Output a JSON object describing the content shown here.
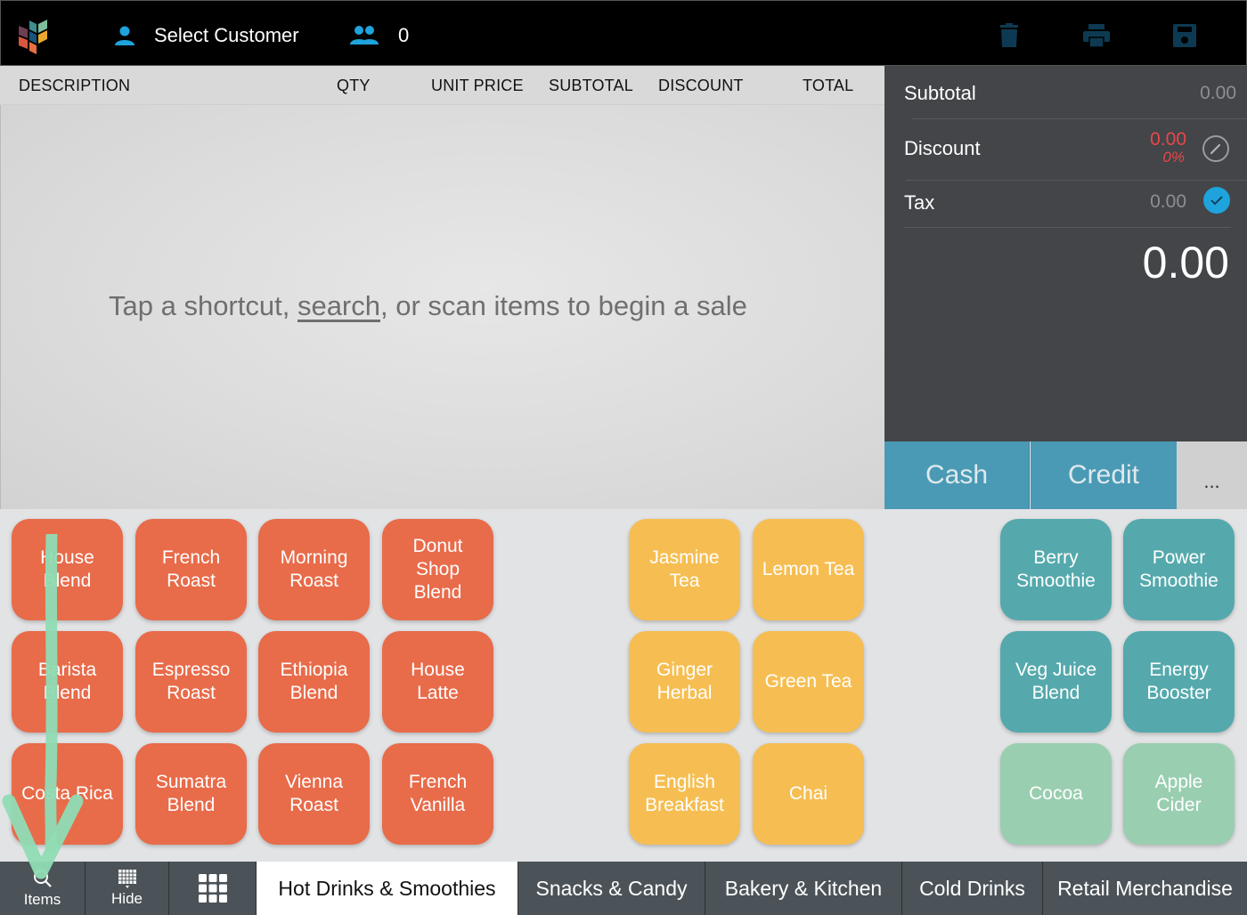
{
  "header": {
    "customer_label": "Select Customer",
    "people_count": "0",
    "icons": [
      "trash-icon",
      "printer-icon",
      "save-icon"
    ],
    "accent_color": "#1ea3dc",
    "icon_color": "#0d3a52"
  },
  "table": {
    "columns": [
      "DESCRIPTION",
      "QTY",
      "UNIT PRICE",
      "SUBTOTAL",
      "DISCOUNT",
      "TOTAL"
    ],
    "rows": [],
    "empty_message": {
      "before": "Tap a shortcut, ",
      "link": "search",
      "after": ", or scan items to begin a sale"
    }
  },
  "totals": {
    "subtotal_label": "Subtotal",
    "subtotal_value": "0.00",
    "discount_label": "Discount",
    "discount_value": "0.00",
    "discount_percent": "0%",
    "tax_label": "Tax",
    "tax_value": "0.00",
    "tax_enabled": true,
    "grand_total": "0.00"
  },
  "payment": {
    "cash_label": "Cash",
    "credit_label": "Credit",
    "more_label": "..."
  },
  "tiles": {
    "coffee_color": "#e86b4a",
    "tea_color": "#f6be52",
    "smoothie_color": "#55a9ac",
    "other_color": "#99ceb0",
    "coffee": [
      [
        "House\nBlend",
        "French\nRoast",
        "Morning\nRoast",
        "Donut\nShop\nBlend"
      ],
      [
        "Barista\nBlend",
        "Espresso\nRoast",
        "Ethiopia\nBlend",
        "House\nLatte"
      ],
      [
        "Costa Rica",
        "Sumatra\nBlend",
        "Vienna\nRoast",
        "French\nVanilla"
      ]
    ],
    "tea": [
      [
        "Jasmine\nTea",
        "Lemon Tea"
      ],
      [
        "Ginger\nHerbal",
        "Green Tea"
      ],
      [
        "English\nBreakfast",
        "Chai"
      ]
    ],
    "smoothie": [
      [
        "Berry\nSmoothie",
        "Power\nSmoothie"
      ],
      [
        "Veg Juice\nBlend",
        "Energy\nBooster"
      ],
      [
        "Cocoa",
        "Apple\nCider"
      ]
    ]
  },
  "bottom": {
    "items_label": "Items",
    "hide_label": "Hide",
    "categories": [
      "Hot Drinks & Smoothies",
      "Snacks & Candy",
      "Bakery & Kitchen",
      "Cold Drinks",
      "Retail Merchandise"
    ],
    "active_category": "Hot Drinks & Smoothies"
  }
}
